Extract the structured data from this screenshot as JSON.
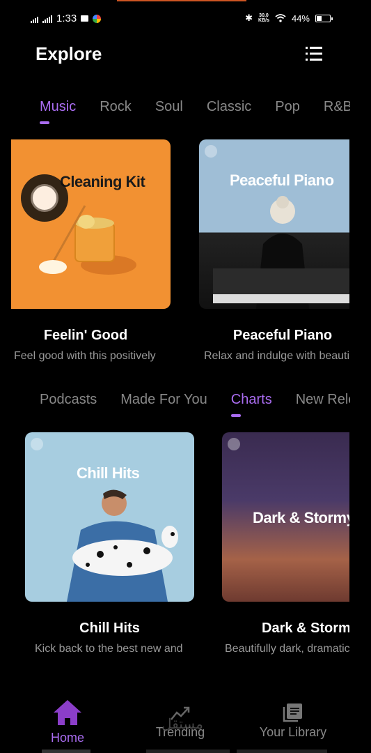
{
  "status": {
    "time": "1:33",
    "net_speed_top": "30.0",
    "net_speed_bottom": "KB/s",
    "battery": "44%",
    "battery_level": 0.44
  },
  "header": {
    "title": "Explore",
    "menu_icon": "list-icon"
  },
  "tabs_top": [
    {
      "label": "Music",
      "active": true
    },
    {
      "label": "Rock",
      "active": false
    },
    {
      "label": "Soul",
      "active": false
    },
    {
      "label": "Classic",
      "active": false
    },
    {
      "label": "Pop",
      "active": false
    },
    {
      "label": "R&B",
      "active": false
    }
  ],
  "cards_top": [
    {
      "cover_text": "Cleaning Kit",
      "title": "Feelin' Good",
      "desc": "Feel good with this positively",
      "color": "#f29132"
    },
    {
      "cover_text": "Peaceful Piano",
      "title": "Peaceful Piano",
      "desc": "Relax and indulge with beautiful piano pieces",
      "color": "#9fbed6"
    }
  ],
  "tabs_bottom": [
    {
      "label": "Podcasts",
      "active": false
    },
    {
      "label": "Made For You",
      "active": false
    },
    {
      "label": "Charts",
      "active": true
    },
    {
      "label": "New Releases",
      "active": false
    }
  ],
  "cards_bottom": [
    {
      "cover_text": "Chill Hits",
      "title": "Chill Hits",
      "desc": "Kick back to the best new and",
      "color": "#a7cde0"
    },
    {
      "cover_text": "Dark & Stormy",
      "title": "Dark & Stormy",
      "desc": "Beautifully dark, dramatic tracks",
      "color": "#3a2b50"
    }
  ],
  "nav": [
    {
      "label": "Home",
      "icon": "home-icon",
      "active": true
    },
    {
      "label": "Trending",
      "icon": "trending-icon",
      "active": false
    },
    {
      "label": "Your Library",
      "icon": "library-icon",
      "active": false
    }
  ],
  "watermark": "مستقل",
  "colors": {
    "accent": "#a96cf0",
    "background": "#000000",
    "muted": "#888888"
  }
}
